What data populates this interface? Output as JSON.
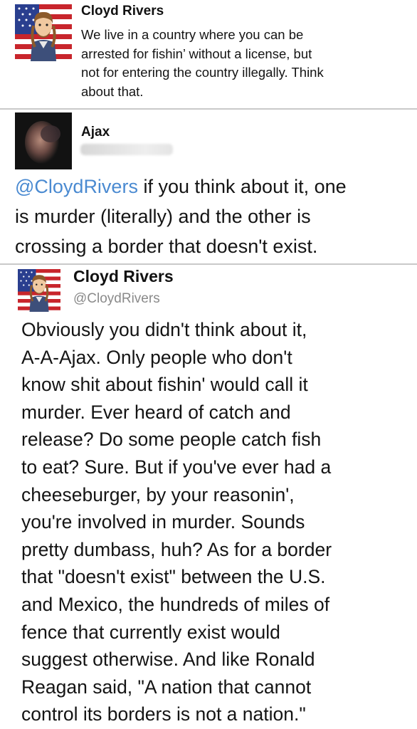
{
  "tweet1": {
    "name": "Cloyd Rivers",
    "text": "We live in a country where you can be\narrested for fishin’ without a license, but\nnot for entering the country illegally. Think\nabout that."
  },
  "tweet2": {
    "name": "Ajax",
    "mention": "@CloydRivers",
    "text": " if you think about it, one\nis murder (literally) and the other is\ncrossing a border that doesn't exist."
  },
  "tweet3": {
    "name": "Cloyd Rivers",
    "handle": "@CloydRivers",
    "text": "Obviously you didn't think about it,\nA-A-Ajax. Only people who don't\nknow shit about fishin' would call it\nmurder. Ever heard of catch and\nrelease? Do some people catch fish\nto eat? Sure. But if you've ever had a\ncheeseburger, by your reasonin',\nyou're involved in murder. Sounds\npretty dumbass, huh? As for a border\nthat \"doesn't exist\" between the U.S.\nand Mexico, the hundreds of miles of\nfence that currently exist would\nsuggest otherwise. And like Ronald\nReagan said, \"A nation that cannot\ncontrol its borders is not a nation.\""
  },
  "colors": {
    "mention": "#4a8ad1",
    "handle": "#8a8a8a",
    "separator": "#c9c9c9"
  }
}
